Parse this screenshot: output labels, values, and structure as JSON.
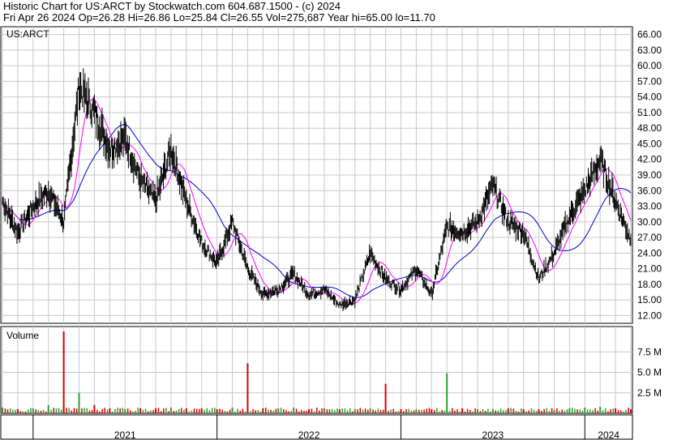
{
  "header": {
    "line1": "Historic Chart for US:ARCT by Stockwatch.com 604.687.1500 - (c) 2024",
    "line2": "Fri Apr 26 2024   Op=26.28   Hi=26.86   Lo=25.84   Cl=26.55   Vol=275,687   Year hi=65.00   lo=11.70"
  },
  "colors": {
    "price": "#000000",
    "ma_short": "#ff00ff",
    "ma_long": "#0000cc",
    "vol_up": "#2ca02c",
    "vol_down": "#dd0000",
    "grid": "#c8c8c8"
  },
  "chart_data": [
    {
      "type": "line",
      "title": "US:ARCT",
      "ylim": [
        10.5,
        67.5
      ],
      "y_ticks": [
        "66.00",
        "63.00",
        "60.00",
        "57.00",
        "54.00",
        "51.00",
        "48.00",
        "45.00",
        "42.00",
        "39.00",
        "36.00",
        "33.00",
        "30.00",
        "27.00",
        "24.00",
        "21.00",
        "18.00",
        "15.00",
        "12.00"
      ],
      "x_ticks": [
        "2021",
        "2022",
        "2023",
        "2024"
      ],
      "x": [
        "2020-11",
        "2020-12",
        "2021-01",
        "2021-02",
        "2021-03",
        "2021-04",
        "2021-05",
        "2021-06",
        "2021-07",
        "2021-08",
        "2021-09",
        "2021-10",
        "2021-11",
        "2021-12",
        "2022-01",
        "2022-02",
        "2022-03",
        "2022-04",
        "2022-05",
        "2022-06",
        "2022-07",
        "2022-08",
        "2022-09",
        "2022-10",
        "2022-11",
        "2022-12",
        "2023-01",
        "2023-02",
        "2023-03",
        "2023-04",
        "2023-05",
        "2023-06",
        "2023-07",
        "2023-08",
        "2023-09",
        "2023-10",
        "2023-11",
        "2023-12",
        "2024-01",
        "2024-02",
        "2024-03",
        "2024-04"
      ],
      "series": [
        {
          "values": [
            34,
            28,
            33,
            36,
            30,
            56,
            51,
            44,
            46,
            38,
            34,
            44,
            34,
            26,
            22,
            30,
            21,
            16,
            17,
            20,
            16,
            17,
            14,
            15,
            24,
            19,
            17,
            21,
            16,
            29,
            28,
            30,
            37,
            30,
            28,
            19,
            24,
            31,
            36,
            42,
            34,
            26.55
          ]
        }
      ]
    },
    {
      "type": "bar",
      "title": "Volume",
      "ylim": [
        0,
        10
      ],
      "y_ticks": [
        "7.5 M",
        "5.0 M",
        "2.5 M"
      ],
      "values": [
        0.7,
        0.5,
        0.6,
        1.0,
        10.0,
        2.5,
        1.0,
        0.6,
        0.5,
        0.6,
        0.6,
        0.7,
        0.6,
        0.6,
        0.5,
        0.7,
        6.1,
        0.6,
        0.6,
        0.7,
        0.5,
        0.6,
        0.5,
        0.5,
        0.6,
        3.6,
        0.5,
        0.5,
        0.5,
        4.9,
        0.6,
        0.5,
        0.5,
        0.6,
        0.5,
        0.5,
        0.4,
        0.6,
        0.7,
        0.8,
        0.6,
        0.5
      ]
    }
  ]
}
